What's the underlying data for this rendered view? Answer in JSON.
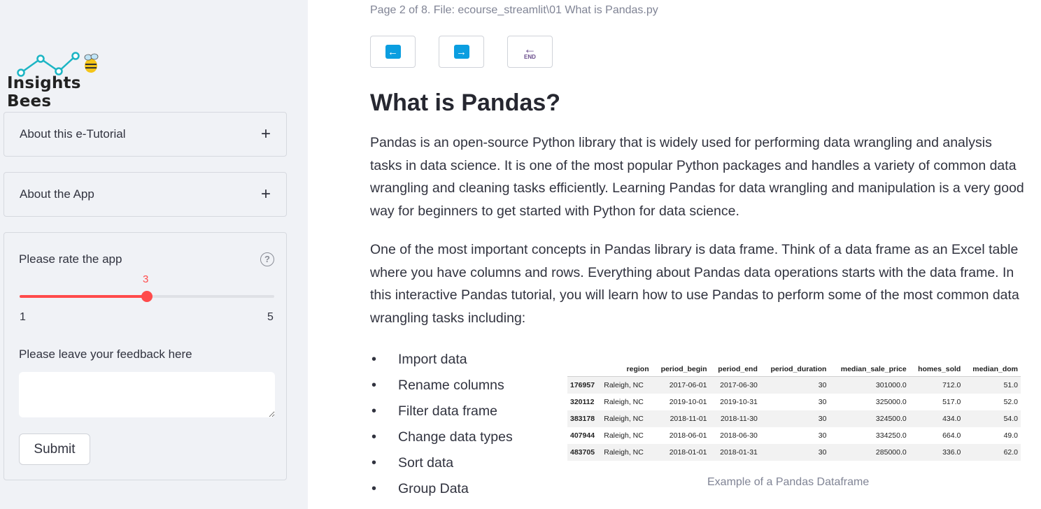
{
  "sidebar": {
    "logo_text": "Insights Bees",
    "expanders": [
      {
        "label": "About this e-Tutorial"
      },
      {
        "label": "About the App"
      }
    ],
    "form": {
      "rate_label": "Please rate the app",
      "slider": {
        "value": "3",
        "min": "1",
        "max": "5",
        "level_fraction": 0.5
      },
      "feedback_label": "Please leave your feedback here",
      "feedback_value": "",
      "submit_label": "Submit"
    }
  },
  "main": {
    "page_info": "Page 2 of 8. File: ecourse_streamlit\\01 What is Pandas.py",
    "nav": {
      "prev_icon": "arrow-left-icon",
      "next_icon": "arrow-right-icon",
      "end_icon": "end-icon",
      "end_text": "END"
    },
    "title": "What is Pandas?",
    "paragraphs": [
      "Pandas is an open-source Python library that is widely used for performing data wrangling and analysis tasks in data science. It is one of the most popular Python packages and handles a variety of common data wrangling and cleaning tasks efficiently. Learning Pandas for data wrangling and manipulation is a very good way for beginners to get started with Python for data science.",
      "One of the most important concepts in Pandas library is data frame. Think of a data frame as an Excel table where you have columns and rows. Everything about Pandas data operations starts with the data frame. In this interactive Pandas tutorial, you will learn how to use Pandas to perform some of the most common data wrangling tasks including:"
    ],
    "bullets": [
      "Import data",
      "Rename columns",
      "Filter data frame",
      "Change data types",
      "Sort data",
      "Group Data"
    ],
    "dataframe": {
      "columns": [
        "",
        "region",
        "period_begin",
        "period_end",
        "period_duration",
        "median_sale_price",
        "homes_sold",
        "median_dom"
      ],
      "rows": [
        [
          "176957",
          "Raleigh, NC",
          "2017-06-01",
          "2017-06-30",
          "30",
          "301000.0",
          "712.0",
          "51.0"
        ],
        [
          "320112",
          "Raleigh, NC",
          "2019-10-01",
          "2019-10-31",
          "30",
          "325000.0",
          "517.0",
          "52.0"
        ],
        [
          "383178",
          "Raleigh, NC",
          "2018-11-01",
          "2018-11-30",
          "30",
          "324500.0",
          "434.0",
          "54.0"
        ],
        [
          "407944",
          "Raleigh, NC",
          "2018-06-01",
          "2018-06-30",
          "30",
          "334250.0",
          "664.0",
          "49.0"
        ],
        [
          "483705",
          "Raleigh, NC",
          "2018-01-01",
          "2018-01-31",
          "30",
          "285000.0",
          "336.0",
          "62.0"
        ]
      ],
      "caption": "Example of a Pandas Dataframe"
    }
  },
  "colors": {
    "accent": "#ff4b4b",
    "sidebar_bg": "#f0f2f6",
    "nav_arrow": "#0b9ee0",
    "end_icon": "#6a4d8c"
  }
}
